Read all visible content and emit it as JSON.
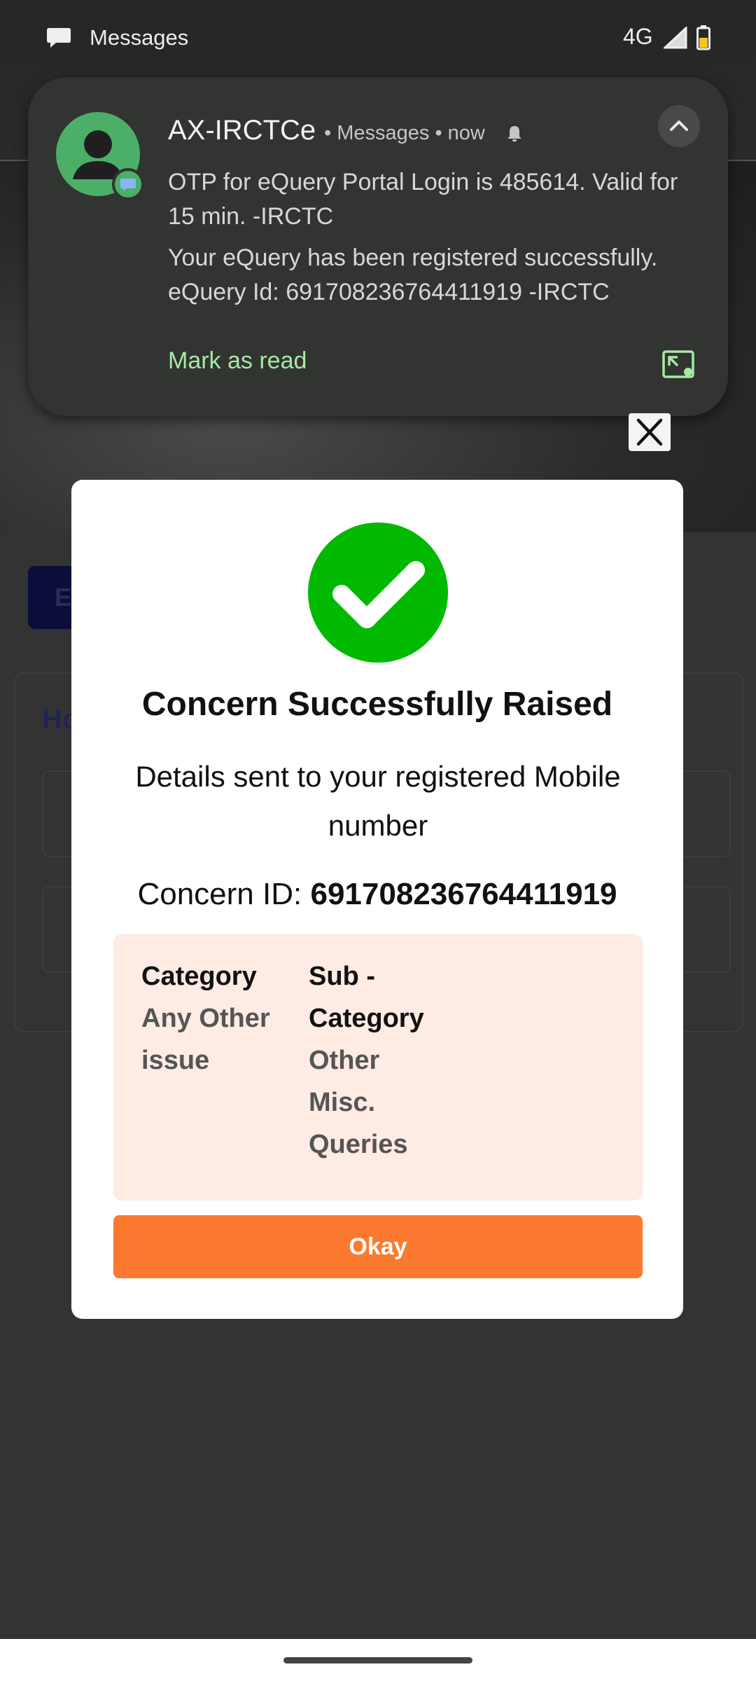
{
  "status_bar": {
    "app_name": "Messages",
    "network": "4G",
    "icons": [
      "messages-icon",
      "signal-icon",
      "battery-icon"
    ]
  },
  "background": {
    "button_initial": "E",
    "card_title_initial": "Ho"
  },
  "notification": {
    "sender": "AX-IRCTCe",
    "meta": "• Messages • now",
    "message_1": "OTP for eQuery Portal Login is 485614. Valid for 15 min. -IRCTC",
    "message_2": "Your eQuery has been registered successfully. eQuery Id: 691708236764411919 -IRCTC",
    "action_label": "Mark as read",
    "icons": [
      "avatar-icon",
      "message-badge-icon",
      "bell-muted-icon",
      "chevron-up-icon",
      "picture-in-picture-icon"
    ]
  },
  "dialog": {
    "title": "Concern Successfully Raised",
    "subtitle": "Details sent to your registered Mobile number",
    "concern_id_label": "Concern ID:",
    "concern_id": "691708236764411919",
    "category_label": "Category",
    "category_value": "Any Other issue",
    "subcategory_label": "Sub - Category",
    "subcategory_value": "Other Misc. Queries",
    "okay_label": "Okay",
    "icons": [
      "checkmark-icon",
      "close-icon"
    ]
  },
  "colors": {
    "success_green": "#00b900",
    "okay_orange": "#fb7a2f",
    "detail_bg": "#fdebe4",
    "notification_bg": "#313431",
    "action_green": "#a6e8a6"
  }
}
